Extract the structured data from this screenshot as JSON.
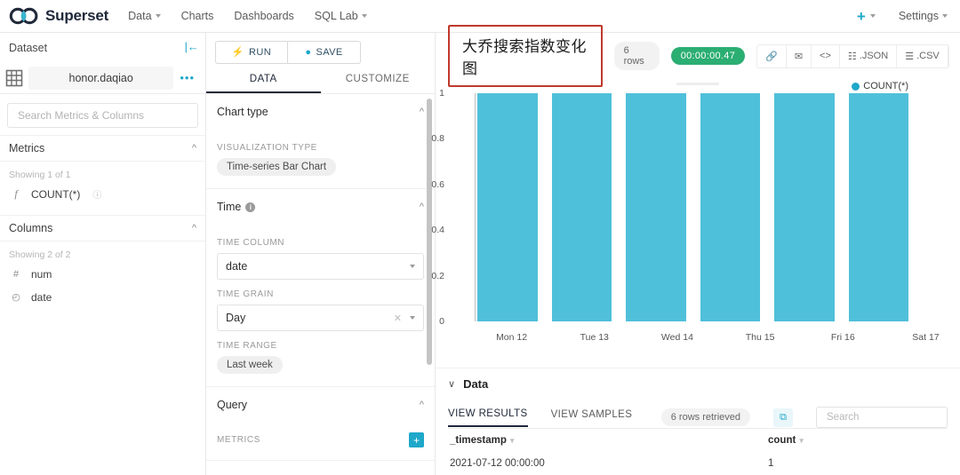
{
  "navbar": {
    "brand": "Superset",
    "items": [
      {
        "label": "Data",
        "caret": true
      },
      {
        "label": "Charts",
        "caret": false
      },
      {
        "label": "Dashboards",
        "caret": false
      },
      {
        "label": "SQL Lab",
        "caret": true
      }
    ],
    "plus_label": "+",
    "settings_label": "Settings"
  },
  "dataset_panel": {
    "title": "Dataset",
    "collapse_icon": "|←",
    "dataset_name": "honor.daqiao",
    "more_icon": "•••",
    "search_placeholder": "Search Metrics & Columns",
    "metrics": {
      "title": "Metrics",
      "showing": "Showing 1 of 1",
      "items": [
        {
          "icon": "f",
          "label": "COUNT(*)",
          "help": "ⓘ"
        }
      ]
    },
    "columns": {
      "title": "Columns",
      "showing": "Showing 2 of 2",
      "items": [
        {
          "icon": "#",
          "label": "num"
        },
        {
          "icon": "◴",
          "label": "date"
        }
      ]
    }
  },
  "control_panel": {
    "run_label": "RUN",
    "save_label": "SAVE",
    "tabs": [
      {
        "label": "DATA",
        "active": true
      },
      {
        "label": "CUSTOMIZE",
        "active": false
      }
    ],
    "chart_type": {
      "title": "Chart type",
      "viz_type_label": "VISUALIZATION TYPE",
      "viz_type_value": "Time-series Bar Chart"
    },
    "time": {
      "title": "Time",
      "time_column_label": "TIME COLUMN",
      "time_column_value": "date",
      "time_grain_label": "TIME GRAIN",
      "time_grain_value": "Day",
      "time_range_label": "TIME RANGE",
      "time_range_value": "Last week"
    },
    "query": {
      "title": "Query",
      "metrics_label": "METRICS",
      "add_icon": "+"
    }
  },
  "chart_header": {
    "title": "大乔搜索指数变化图",
    "rows_badge": "6 rows",
    "duration_badge": "00:00:00.47",
    "actions": [
      {
        "icon": "🔗",
        "label": ""
      },
      {
        "icon": "✉",
        "label": ""
      },
      {
        "icon": "<>",
        "label": ""
      },
      {
        "icon": "☷",
        "label": ".JSON"
      },
      {
        "icon": "☰",
        "label": ".CSV"
      },
      {
        "icon": "≡",
        "label": ""
      }
    ]
  },
  "chart_data": {
    "type": "bar",
    "title": "大乔搜索指数变化图",
    "categories": [
      "Mon 12",
      "Tue 13",
      "Wed 14",
      "Thu 15",
      "Fri 16",
      "Sat 17"
    ],
    "series": [
      {
        "name": "COUNT(*)",
        "values": [
          1,
          1,
          1,
          1,
          1,
          1
        ],
        "color": "#4FC0DA"
      }
    ],
    "xlabel": "",
    "ylabel": "",
    "ylim": [
      0,
      1
    ],
    "yticks": [
      "0",
      "0.2",
      "0.4",
      "0.6",
      "0.8",
      "1"
    ],
    "legend": [
      "COUNT(*)"
    ],
    "legend_position": "top-right",
    "grid": false
  },
  "data_panel": {
    "title": "Data",
    "chevron": "∨",
    "tabs": [
      {
        "label": "VIEW RESULTS",
        "active": true
      },
      {
        "label": "VIEW SAMPLES",
        "active": false
      }
    ],
    "retrieved_badge": "6 rows retrieved",
    "copy_icon": "⧉",
    "search_placeholder": "Search",
    "table": {
      "columns": [
        "_timestamp",
        "count"
      ],
      "rows": [
        [
          "2021-07-12 00:00:00",
          "1"
        ]
      ]
    }
  }
}
